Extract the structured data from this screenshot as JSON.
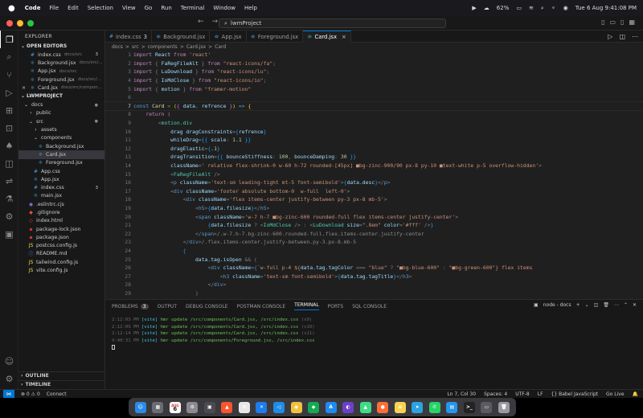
{
  "menubar": {
    "apple": "",
    "items": [
      "Code",
      "File",
      "Edit",
      "Selection",
      "View",
      "Go",
      "Run",
      "Terminal",
      "Window",
      "Help"
    ],
    "battery": "62%",
    "datetime": "Tue 6 Aug  9:41:08 PM"
  },
  "titlebar": {
    "search": "lwmProject"
  },
  "sidebar": {
    "header": "EXPLORER",
    "open_editors_label": "OPEN EDITORS",
    "open_editors": [
      {
        "name": "index.css",
        "path": "docs/src",
        "badge": "3",
        "icon": "css"
      },
      {
        "name": "Background.jsx",
        "path": "docs/src/...",
        "badge": "",
        "icon": "react"
      },
      {
        "name": "App.jsx",
        "path": "docs/src",
        "badge": "",
        "icon": "react"
      },
      {
        "name": "Foreground.jsx",
        "path": "docs/src/...",
        "badge": "",
        "icon": "react"
      },
      {
        "name": "Card.jsx",
        "path": "docs/src/compon...",
        "badge": "",
        "icon": "react",
        "close": "×"
      }
    ],
    "project_label": "LWMPROJECT",
    "tree": [
      {
        "name": "docs",
        "indent": 1,
        "icon": "chev-down",
        "dot": "●"
      },
      {
        "name": "public",
        "indent": 2,
        "icon": "folder"
      },
      {
        "name": "src",
        "indent": 2,
        "icon": "chev-down",
        "dot": "●"
      },
      {
        "name": "assets",
        "indent": 3,
        "icon": "folder"
      },
      {
        "name": "components",
        "indent": 3,
        "icon": "chev-down"
      },
      {
        "name": "Background.jsx",
        "indent": 4,
        "icon": "react"
      },
      {
        "name": "Card.jsx",
        "indent": 4,
        "icon": "react",
        "selected": true
      },
      {
        "name": "Foreground.jsx",
        "indent": 4,
        "icon": "react"
      },
      {
        "name": "App.css",
        "indent": 3,
        "icon": "css"
      },
      {
        "name": "App.jsx",
        "indent": 3,
        "icon": "react"
      },
      {
        "name": "index.css",
        "indent": 3,
        "icon": "css",
        "badge": "3"
      },
      {
        "name": "main.jsx",
        "indent": 3,
        "icon": "react"
      },
      {
        "name": ".eslintrc.cjs",
        "indent": 2,
        "icon": "eslint"
      },
      {
        "name": ".gitignore",
        "indent": 2,
        "icon": "git"
      },
      {
        "name": "index.html",
        "indent": 2,
        "icon": "html"
      },
      {
        "name": "package-lock.json",
        "indent": 2,
        "icon": "npm"
      },
      {
        "name": "package.json",
        "indent": 2,
        "icon": "npm"
      },
      {
        "name": "postcss.config.js",
        "indent": 2,
        "icon": "js"
      },
      {
        "name": "README.md",
        "indent": 2,
        "icon": "info"
      },
      {
        "name": "tailwind.config.js",
        "indent": 2,
        "icon": "js"
      },
      {
        "name": "vite.config.js",
        "indent": 2,
        "icon": "js"
      }
    ],
    "outline_label": "OUTLINE",
    "timeline_label": "TIMELINE"
  },
  "tabs": [
    {
      "label": "index.css",
      "icon": "css",
      "badge": "3"
    },
    {
      "label": "Background.jsx",
      "icon": "react"
    },
    {
      "label": "App.jsx",
      "icon": "react"
    },
    {
      "label": "Foreground.jsx",
      "icon": "react"
    },
    {
      "label": "Card.jsx",
      "icon": "react",
      "active": true,
      "close": "×"
    }
  ],
  "breadcrumb": [
    "docs",
    ">",
    "src",
    ">",
    "components",
    ">",
    "Card.jsx",
    ">",
    "Card"
  ],
  "editor": {
    "current_line": 7,
    "lines": [
      [
        [
          "kw",
          "import "
        ],
        [
          "var",
          "React "
        ],
        [
          "kw",
          "from "
        ],
        [
          "str",
          "'react'"
        ]
      ],
      [
        [
          "kw",
          "import "
        ],
        [
          "pun",
          "{ "
        ],
        [
          "var",
          "FaRegFileAlt "
        ],
        [
          "pun",
          "} "
        ],
        [
          "kw",
          "from "
        ],
        [
          "str",
          "\"react-icons/fa\""
        ],
        [
          "pun",
          ";"
        ]
      ],
      [
        [
          "kw",
          "import "
        ],
        [
          "pun",
          "{ "
        ],
        [
          "var",
          "LuDownload "
        ],
        [
          "pun",
          "} "
        ],
        [
          "kw",
          "from "
        ],
        [
          "str",
          "\"react-icons/lu\""
        ],
        [
          "pun",
          ";"
        ]
      ],
      [
        [
          "kw",
          "import "
        ],
        [
          "pun",
          "{ "
        ],
        [
          "var",
          "IoMdClose "
        ],
        [
          "pun",
          "} "
        ],
        [
          "kw",
          "from "
        ],
        [
          "str",
          "\"react-icons/io\""
        ],
        [
          "pun",
          ";"
        ]
      ],
      [
        [
          "kw",
          "import "
        ],
        [
          "pun",
          "{ "
        ],
        [
          "var",
          "motion "
        ],
        [
          "pun",
          "} "
        ],
        [
          "kw",
          "from "
        ],
        [
          "str",
          "\"framer-motion\""
        ]
      ],
      [],
      [
        [
          "kw2",
          "const "
        ],
        [
          "fn",
          "Card "
        ],
        [
          "pun",
          "= "
        ],
        [
          "br",
          "("
        ],
        [
          "br2",
          "{ "
        ],
        [
          "var",
          "data"
        ],
        [
          "pun",
          ", "
        ],
        [
          "var",
          "refrence "
        ],
        [
          "br2",
          "}"
        ],
        [
          "br",
          ")"
        ],
        [
          "kw2",
          " => "
        ],
        [
          "br",
          "{"
        ]
      ],
      [
        [
          "gray",
          "    "
        ],
        [
          "kw",
          "return "
        ],
        [
          "br2",
          "("
        ]
      ],
      [
        [
          "gray",
          "        "
        ],
        [
          "pun",
          "<"
        ],
        [
          "tag",
          "motion.div"
        ]
      ],
      [
        [
          "gray",
          "            "
        ],
        [
          "attr",
          "drag "
        ],
        [
          "attr",
          "dragConstraints"
        ],
        [
          "pun",
          "="
        ],
        [
          "br3",
          "{"
        ],
        [
          "var",
          "refrence"
        ],
        [
          "br3",
          "}"
        ]
      ],
      [
        [
          "gray",
          "            "
        ],
        [
          "attr",
          "whileDrag"
        ],
        [
          "pun",
          "="
        ],
        [
          "br3",
          "{{ "
        ],
        [
          "var",
          "scale"
        ],
        [
          "pun",
          ": "
        ],
        [
          "num",
          "1.1 "
        ],
        [
          "br3",
          "}}"
        ]
      ],
      [
        [
          "gray",
          "            "
        ],
        [
          "attr",
          "dragElastic"
        ],
        [
          "pun",
          "="
        ],
        [
          "br3",
          "{"
        ],
        [
          "num",
          ".1"
        ],
        [
          "br3",
          "}"
        ]
      ],
      [
        [
          "gray",
          "            "
        ],
        [
          "attr",
          "dragTransition"
        ],
        [
          "pun",
          "="
        ],
        [
          "br3",
          "{{ "
        ],
        [
          "var",
          "bounceStiffness"
        ],
        [
          "pun",
          ": "
        ],
        [
          "num",
          "100"
        ],
        [
          "pun",
          ", "
        ],
        [
          "var",
          "bounceDamping"
        ],
        [
          "pun",
          ": "
        ],
        [
          "num",
          "30 "
        ],
        [
          "br3",
          "}}"
        ]
      ],
      [
        [
          "gray",
          "            "
        ],
        [
          "attr",
          "className"
        ],
        [
          "pun",
          "="
        ],
        [
          "str",
          "' relative flex-shrink-0 w-60 h-72 rounded-[45px] ■bg-zinc-900/90 px-8 py-10 ■text-white p-5 overflow-hidden'"
        ],
        [
          "pun",
          ">"
        ]
      ],
      [
        [
          "gray",
          "            "
        ],
        [
          "pun",
          "<"
        ],
        [
          "tag",
          "FaRegFileAlt "
        ],
        [
          "pun",
          "/>"
        ]
      ],
      [
        [
          "gray",
          "            "
        ],
        [
          "pun",
          "<"
        ],
        [
          "kw2",
          "p "
        ],
        [
          "attr",
          "className"
        ],
        [
          "pun",
          "="
        ],
        [
          "str",
          "'text-sm leading-tight mt-5 font-semibold'"
        ],
        [
          "pun",
          ">"
        ],
        [
          "br3",
          "{"
        ],
        [
          "var",
          "data.desc"
        ],
        [
          "br3",
          "}"
        ],
        [
          "pun",
          "</"
        ],
        [
          "kw2",
          "p"
        ],
        [
          "pun",
          ">"
        ]
      ],
      [
        [
          "gray",
          "            "
        ],
        [
          "pun",
          "<"
        ],
        [
          "kw2",
          "div "
        ],
        [
          "attr",
          "className"
        ],
        [
          "pun",
          "="
        ],
        [
          "str",
          "'footer absolute bottom-0  w-full  left-0'"
        ],
        [
          "pun",
          ">"
        ]
      ],
      [
        [
          "gray",
          "                "
        ],
        [
          "pun",
          "<"
        ],
        [
          "kw2",
          "div "
        ],
        [
          "attr",
          "className"
        ],
        [
          "pun",
          "="
        ],
        [
          "str",
          "'flex items-center justify-between py-3 px-8 mb-5'"
        ],
        [
          "pun",
          ">"
        ]
      ],
      [
        [
          "gray",
          "                    "
        ],
        [
          "pun",
          "<"
        ],
        [
          "kw2",
          "h5"
        ],
        [
          "pun",
          ">"
        ],
        [
          "br3",
          "{"
        ],
        [
          "var",
          "data.filesize"
        ],
        [
          "br3",
          "}"
        ],
        [
          "pun",
          "</"
        ],
        [
          "kw2",
          "h5"
        ],
        [
          "pun",
          ">"
        ]
      ],
      [
        [
          "gray",
          "                    "
        ],
        [
          "pun",
          "<"
        ],
        [
          "kw2",
          "span "
        ],
        [
          "attr",
          "className"
        ],
        [
          "pun",
          "="
        ],
        [
          "str",
          "'w-7 h-7 ■bg-zinc-600 rounded-full flex items-center justify-center'"
        ],
        [
          "pun",
          ">"
        ]
      ],
      [
        [
          "gray",
          "                        "
        ],
        [
          "br3",
          "{"
        ],
        [
          "var",
          "data.filesize "
        ],
        [
          "pun",
          "? <"
        ],
        [
          "tag",
          "IoMdClose "
        ],
        [
          "pun",
          "/> : <"
        ],
        [
          "tag",
          "LuDownload "
        ],
        [
          "attr",
          "size"
        ],
        [
          "pun",
          "="
        ],
        [
          "str",
          "\".8em\" "
        ],
        [
          "attr",
          "color"
        ],
        [
          "pun",
          "="
        ],
        [
          "str",
          "'#fff' "
        ],
        [
          "pun",
          "/>"
        ],
        [
          "br3",
          "}"
        ]
      ],
      [
        [
          "gray",
          "                    "
        ],
        [
          "pun",
          "</"
        ],
        [
          "kw2",
          "span"
        ],
        [
          "pun",
          ">"
        ],
        [
          "gray",
          "/.w-7.h-7.bg-zinc-600.rounded-full.flex.items-center.justify-center"
        ]
      ],
      [
        [
          "gray",
          "                "
        ],
        [
          "pun",
          "</"
        ],
        [
          "kw2",
          "div"
        ],
        [
          "pun",
          ">"
        ],
        [
          "gray",
          "/.flex.items-center.justify-between.py-3.px-8.mb-5"
        ]
      ],
      [
        [
          "gray",
          "                "
        ],
        [
          "br3",
          "{"
        ]
      ],
      [
        [
          "gray",
          "                    "
        ],
        [
          "var",
          "data.tag.isOpen "
        ],
        [
          "pun",
          "&& ("
        ]
      ],
      [
        [
          "gray",
          "                        "
        ],
        [
          "pun",
          "<"
        ],
        [
          "kw2",
          "div "
        ],
        [
          "attr",
          "className"
        ],
        [
          "pun",
          "="
        ],
        [
          "br3",
          "{"
        ],
        [
          "str",
          "`w-full p-4 ${"
        ],
        [
          "var",
          "data.tag.tagColor "
        ],
        [
          "pun",
          "=== "
        ],
        [
          "str",
          "\"blue\" "
        ],
        [
          "pun",
          "? "
        ],
        [
          "str",
          "\"■bg-blue-600\" "
        ],
        [
          "pun",
          ": "
        ],
        [
          "str",
          "\"■bg-green-600\""
        ],
        [
          "str",
          "} flex items"
        ]
      ],
      [
        [
          "gray",
          "                            "
        ],
        [
          "pun",
          "<"
        ],
        [
          "kw2",
          "h3 "
        ],
        [
          "attr",
          "className"
        ],
        [
          "pun",
          "="
        ],
        [
          "str",
          "'text-sm font-semibold'"
        ],
        [
          "pun",
          ">"
        ],
        [
          "br3",
          "{"
        ],
        [
          "var",
          "data.tag.tagTitle"
        ],
        [
          "br3",
          "}"
        ],
        [
          "pun",
          "</"
        ],
        [
          "kw2",
          "h3"
        ],
        [
          "pun",
          ">"
        ]
      ],
      [
        [
          "gray",
          "                        "
        ],
        [
          "pun",
          "</"
        ],
        [
          "kw2",
          "div"
        ],
        [
          "pun",
          ">"
        ]
      ],
      [
        [
          "gray",
          "                    "
        ],
        [
          "pun",
          ")"
        ]
      ]
    ]
  },
  "panel": {
    "tabs": [
      "PROBLEMS",
      "OUTPUT",
      "DEBUG CONSOLE",
      "POSTMAN CONSOLE",
      "TERMINAL",
      "PORTS",
      "SQL CONSOLE"
    ],
    "problems_count": "3",
    "active_tab": "TERMINAL",
    "terminal_name": "node - docs",
    "terminal_lines": [
      {
        "time": "2:12:03 PM",
        "tag": "[vite]",
        "msg": " hmr update /src/components/Card.jsx, /src/index.css",
        "count": " (x9)"
      },
      {
        "time": "2:12:09 PM",
        "tag": "[vite]",
        "msg": " hmr update /src/components/Card.jsx, /src/index.css",
        "count": " (x10)"
      },
      {
        "time": "2:12:14 PM",
        "tag": "[vite]",
        "msg": " hmr update /src/components/Card.jsx, /src/index.css",
        "count": " (x11)"
      },
      {
        "time": "9:40:31 PM",
        "tag": "[vite]",
        "msg": " hmr update /src/components/Foreground.jsx, /src/index.css",
        "count": ""
      }
    ]
  },
  "statusbar": {
    "left": [
      "⊗ 0 ⚠ 0",
      "Connect"
    ],
    "right": [
      "Ln 7, Col 30",
      "Spaces: 4",
      "UTF-8",
      "LF",
      "{} Babel JavaScript",
      "Go Live"
    ]
  },
  "dock": {
    "date_day": "6",
    "date_month": "AUG",
    "apps": [
      {
        "name": "finder",
        "color": "#2b8ae8",
        "glyph": "☺"
      },
      {
        "name": "launchpad",
        "color": "#6b6b74",
        "glyph": "▦"
      },
      {
        "name": "calendar",
        "color": "#ffffff",
        "glyph": ""
      },
      {
        "name": "settings",
        "color": "#8a8a90",
        "glyph": "⚙"
      },
      {
        "name": "system-info",
        "color": "#4a4a50",
        "glyph": "▣"
      },
      {
        "name": "brave",
        "color": "#fb542b",
        "glyph": "▲"
      },
      {
        "name": "photos",
        "color": "#e7e7e7",
        "glyph": "✿"
      },
      {
        "name": "xcode",
        "color": "#1c7cf0",
        "glyph": "✕"
      },
      {
        "name": "vscode",
        "color": "#1e8ce8",
        "glyph": "◁"
      },
      {
        "name": "chrome",
        "color": "#f3c13a",
        "glyph": "◉"
      },
      {
        "name": "mongodb",
        "color": "#13aa52",
        "glyph": "◆"
      },
      {
        "name": "app-store",
        "color": "#1d8bf1",
        "glyph": "A"
      },
      {
        "name": "github",
        "color": "#6e40c9",
        "glyph": "◐"
      },
      {
        "name": "android-studio",
        "color": "#3ddc84",
        "glyph": "▲"
      },
      {
        "name": "postman",
        "color": "#ff6c37",
        "glyph": "●"
      },
      {
        "name": "notes",
        "color": "#f7d34f",
        "glyph": "≡"
      },
      {
        "name": "telegram",
        "color": "#2aa3e0",
        "glyph": "➤"
      },
      {
        "name": "whatsapp",
        "color": "#25d366",
        "glyph": "✆"
      },
      {
        "name": "docker",
        "color": "#2396ed",
        "glyph": "▤"
      },
      {
        "name": "terminal",
        "color": "#222",
        "glyph": ">_"
      },
      {
        "name": "preview",
        "color": "#5a5a60",
        "glyph": "▭"
      },
      {
        "name": "trash",
        "color": "#9a9aa0",
        "glyph": "🗑"
      }
    ]
  },
  "colors": {
    "accent": "#0078d4",
    "react_icon": "#4fc1ff",
    "css_icon": "#42a5f5"
  }
}
